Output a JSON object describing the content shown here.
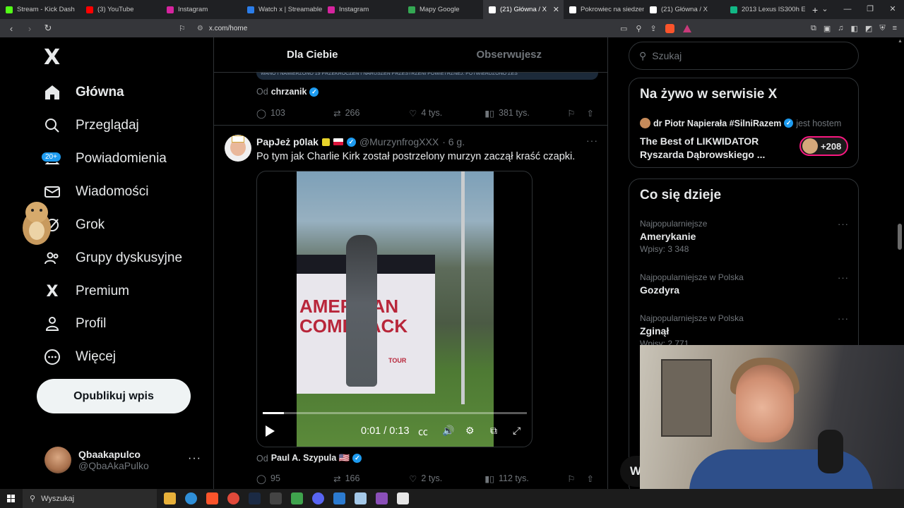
{
  "browser": {
    "tabs": [
      {
        "label": "Stream - Kick Dash",
        "color": "#53fc18",
        "active": false
      },
      {
        "label": "(3) YouTube",
        "color": "#ff0000",
        "active": false
      },
      {
        "label": "Instagram",
        "color": "#d6249f",
        "active": false
      },
      {
        "label": "Watch x | Streamable",
        "color": "#2b7de9",
        "active": false
      },
      {
        "label": "Instagram",
        "color": "#d6249f",
        "active": false
      },
      {
        "label": "Mapy Google",
        "color": "#34a853",
        "active": false
      },
      {
        "label": "(21) Główna / X",
        "color": "#ffffff",
        "active": true
      },
      {
        "label": "Pokrowiec na siedzenie",
        "color": "#ffffff",
        "active": false
      },
      {
        "label": "(21) Główna / X",
        "color": "#ffffff",
        "active": false
      },
      {
        "label": "2013 Lexus IS300h Elit",
        "color": "#12b886",
        "active": false
      }
    ],
    "new_tab": "+",
    "url": "x.com/home"
  },
  "nav": {
    "logo": "X",
    "items": [
      {
        "label": "Główna",
        "icon": "home-icon",
        "active": true
      },
      {
        "label": "Przeglądaj",
        "icon": "search-icon",
        "active": false
      },
      {
        "label": "Powiadomienia",
        "icon": "bell-icon",
        "active": false,
        "badge": "20+"
      },
      {
        "label": "Wiadomości",
        "icon": "mail-icon",
        "active": false
      },
      {
        "label": "Grok",
        "icon": "grok-icon",
        "active": false
      },
      {
        "label": "Grupy dyskusyjne",
        "icon": "people-icon",
        "active": false
      },
      {
        "label": "Premium",
        "icon": "x-premium-icon",
        "active": false
      },
      {
        "label": "Profil",
        "icon": "profile-icon",
        "active": false
      },
      {
        "label": "Więcej",
        "icon": "more-circle-icon",
        "active": false
      }
    ],
    "post_button": "Opublikuj wpis",
    "profile": {
      "name": "Qbaakapulco",
      "handle": "@QbaAkaPulko",
      "more": "···"
    }
  },
  "timeline": {
    "tabs": [
      "Dla Ciebie",
      "Obserwujesz"
    ],
    "banner_text": "WANO I NAMIERZONO 19 PRZEKROCZEŃ I NARUSZEŃ PRZESTRZENI POWIETRZNEJ. POTWIERDZONO ZES",
    "prev_tweet": {
      "from_prefix": "Od",
      "from_name": "chrzanik",
      "replies": "103",
      "reposts": "266",
      "likes": "4 tys.",
      "views": "381 tys."
    },
    "tweet": {
      "name": "PapJeż p0lak",
      "handle": "@MurzynfrogXXX",
      "time": "· 6 g.",
      "more": "···",
      "text": "Po tym jak Charlie Kirk został postrzelony murzyn zaczął kraść czapki.",
      "video": {
        "time": "0:01 / 0:13",
        "progress": 0.08,
        "booth_text": "AMERICAN\nCOMEBACK",
        "booth_sub": "TOUR"
      },
      "from_prefix": "Od",
      "from_name": "Paul A. Szypula 🇺🇸",
      "replies": "95",
      "reposts": "166",
      "likes": "2 tys.",
      "views": "112 tys."
    }
  },
  "sidebar": {
    "search_placeholder": "Szukaj",
    "live": {
      "title": "Na żywo w serwisie X",
      "host_name": "dr Piotr Napierała #SilniRazem",
      "host_suffix": "jest hostem",
      "space_title": "The Best of LIKWIDATOR Ryszarda Dąbrowskiego ...",
      "listeners": "+208"
    },
    "trends": {
      "title": "Co się dzieje",
      "items": [
        {
          "context": "Najpopularniejsze",
          "name": "Amerykanie",
          "count": "Wpisy: 3 348"
        },
        {
          "context": "Najpopularniejsze w Polska",
          "name": "Gozdyra",
          "count": ""
        },
        {
          "context": "Najpopularniejsze w Polska",
          "name": "Zginął",
          "count": "Wpisy: 2 771"
        }
      ]
    }
  },
  "overlay": {
    "partial_label": "W"
  },
  "taskbar": {
    "search": "Wyszukaj"
  }
}
